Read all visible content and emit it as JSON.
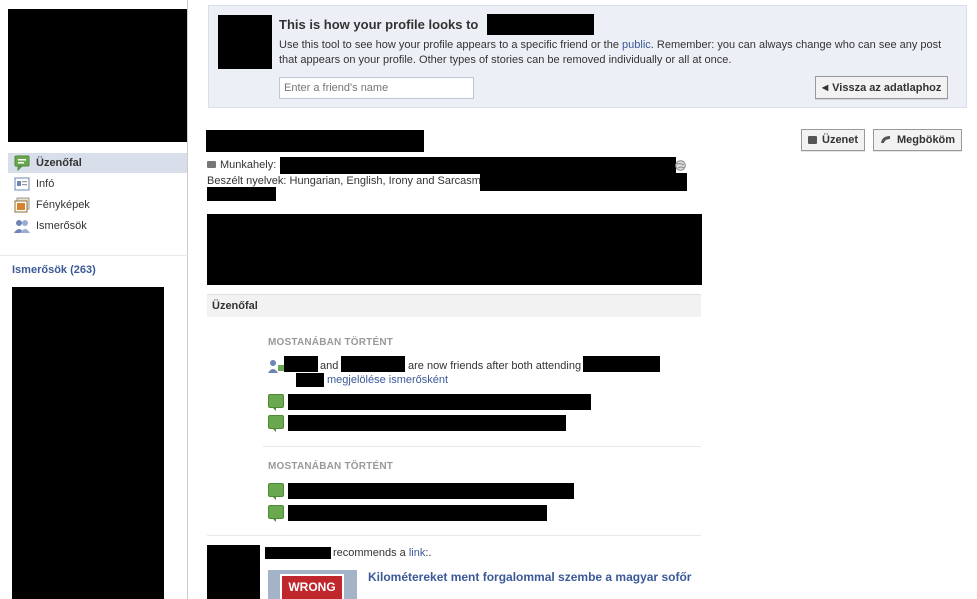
{
  "preview": {
    "title": "This is how your profile looks to",
    "desc_part1": "Use this tool to see how your profile appears to a specific friend or the ",
    "desc_link": "public",
    "desc_part2": ". Remember: you can always change who can see any post that appears on your profile. Other types of stories can be removed individually or all at once.",
    "input_placeholder": "Enter a friend's name",
    "back_button": "Vissza az adatlaphoz"
  },
  "actions": {
    "message": "Üzenet",
    "poke": "Megbököm"
  },
  "sidebar": {
    "items": [
      {
        "label": "Üzenőfal",
        "icon": "wall-icon"
      },
      {
        "label": "Infó",
        "icon": "info-icon"
      },
      {
        "label": "Fényképek",
        "icon": "photos-icon"
      },
      {
        "label": "Ismerősök",
        "icon": "friends-icon"
      }
    ],
    "friends_header": "Ismerősök (263)"
  },
  "profile": {
    "work_label": "Munkahely:",
    "languages_label": "Beszélt nyelvek:",
    "languages_value": "Hungarian, English, Irony and Sarcasm"
  },
  "wall": {
    "header": "Üzenőfal",
    "recent_label_1": "MOSTANÁBAN TÖRTÉNT",
    "recent_label_2": "MOSTANÁBAN TÖRTÉNT",
    "friends_and": "and",
    "friends_text": "are now friends after both attending",
    "tag_link": "megjelölése ismerősként",
    "recommends_text": "recommends a",
    "recommends_link": "link",
    "recommends_suffix": ":.",
    "link_title": "Kilométereket ment forgalommal szembe a magyar sofőr",
    "sign_text": "WRONG WAY"
  },
  "colors": {
    "link": "#3b5998",
    "active_nav": "#d8dfea",
    "preview_bg": "#eceff5"
  }
}
